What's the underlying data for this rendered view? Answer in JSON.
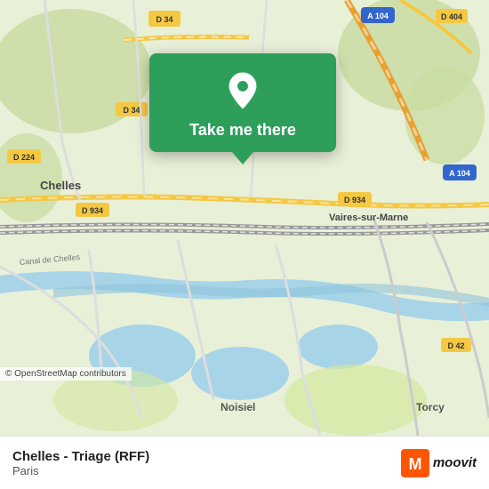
{
  "map": {
    "attribution": "© OpenStreetMap contributors",
    "bg_color": "#e8f0d8"
  },
  "popup": {
    "cta_label": "Take me there",
    "pin_color": "#fff"
  },
  "bottom_bar": {
    "station_name": "Chelles - Triage (RFF)",
    "city": "Paris",
    "logo_text": "moovit"
  },
  "labels": {
    "d34_top": "D 34",
    "d34_mid": "D 34",
    "d224": "D 224",
    "d934_left": "D 934",
    "d934_right": "D 934",
    "a104_top_right": "A 104",
    "a104_mid_right": "A 104",
    "d404": "D 404",
    "d42": "D 42",
    "chelles": "Chelles",
    "vaires": "Vaires-sur-Marne",
    "canal": "Canal de Chelles",
    "noisiel": "Noisiel",
    "torcy": "Torcy"
  }
}
